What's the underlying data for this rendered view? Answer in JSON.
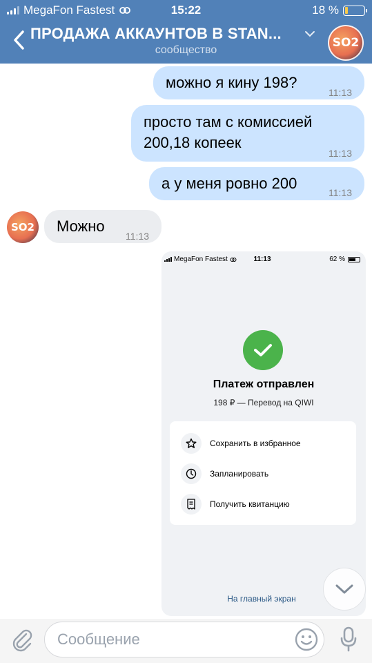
{
  "status_bar": {
    "carrier": "MegaFon Fastest",
    "time": "15:22",
    "battery": "18 %",
    "battery_level": 0.18
  },
  "header": {
    "title": "ПРОДАЖА АККАУНТОВ В STAN...",
    "subtitle": "сообщество",
    "avatar_text": "SO2"
  },
  "messages": [
    {
      "direction": "out",
      "text": "можно я кину 198?",
      "time": "11:13"
    },
    {
      "direction": "out",
      "text": "просто там с комиссией\n200,18 копеек",
      "time": "11:13"
    },
    {
      "direction": "out",
      "text": "а у меня ровно 200",
      "time": "11:13"
    },
    {
      "direction": "in",
      "text": "Можно",
      "time": "11:13"
    }
  ],
  "screenshot": {
    "carrier": "MegaFon Fastest",
    "time": "11:13",
    "battery": "62 %",
    "battery_level": 0.62,
    "title": "Платеж отправлен",
    "subtitle": "198 ₽ — Перевод на QIWI",
    "actions": [
      {
        "label": "Сохранить в избранное",
        "icon": "star-icon"
      },
      {
        "label": "Запланировать",
        "icon": "clock-icon"
      },
      {
        "label": "Получить квитанцию",
        "icon": "receipt-icon"
      }
    ],
    "home_link": "На главный экран"
  },
  "composer": {
    "placeholder": "Сообщение"
  },
  "colors": {
    "header": "#5181b8",
    "outgoing": "#cce4ff",
    "incoming": "#ebedf0",
    "success": "#4bb34b",
    "link": "#2a5885"
  }
}
